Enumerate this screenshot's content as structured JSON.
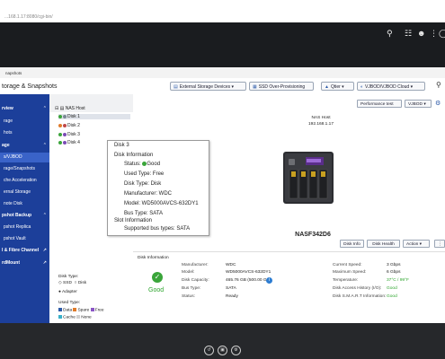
{
  "browser": {
    "url": "...168.1.17:8080/cgi-bin/"
  },
  "app": {
    "title": "torage & Snapshots",
    "tab_label": "napshots"
  },
  "toolbar": {
    "external": "External Storage Devices",
    "ssd": "SSD Over-Provisioning",
    "qtier": "Qtier",
    "vjbod": "VJBOD/VJBOD Cloud"
  },
  "nav": {
    "items": [
      {
        "label": "rview",
        "type": "sect"
      },
      {
        "label": "rage",
        "type": "sub"
      },
      {
        "label": "hots",
        "type": "sub"
      },
      {
        "label": "age",
        "type": "sect"
      },
      {
        "label": "s/VJBOD",
        "type": "sub",
        "active": true
      },
      {
        "label": "rage/Snapshots",
        "type": "sub"
      },
      {
        "label": "che Acceleration",
        "type": "sub"
      },
      {
        "label": "ernal Storage",
        "type": "sub"
      },
      {
        "label": "note Disk",
        "type": "sub"
      },
      {
        "label": "pshot Backup",
        "type": "sect"
      },
      {
        "label": "pshot Replica",
        "type": "sub"
      },
      {
        "label": "pshot Vault",
        "type": "sub"
      },
      {
        "label": "I & Fibre Channel",
        "type": "sect"
      },
      {
        "label": "rdMount",
        "type": "sect"
      }
    ]
  },
  "tree": {
    "host": "NAS Host",
    "disks": [
      {
        "label": "Disk 1",
        "color": "#3aa53a"
      },
      {
        "label": "Disk 2",
        "color": "#e07b2a"
      },
      {
        "label": "Disk 3",
        "color": "#3aa53a"
      },
      {
        "label": "Disk 4",
        "color": "#3aa53a"
      }
    ],
    "disk_type_label": "Disk Type:",
    "disk_types": [
      "SSD",
      "Disk",
      "Adapter"
    ],
    "used_type_label": "Used Type:",
    "used_types": [
      "Data",
      "Spare",
      "Free",
      "Cache",
      "None"
    ]
  },
  "tooltip": {
    "title": "Disk 3",
    "section1": "Disk Information",
    "status_label": "Status:",
    "status_value": "Good",
    "used_type": "Used Type: Free",
    "disk_type": "Disk Type: Disk",
    "manufacturer": "Manufacturer: WDC",
    "model": "Model: WD5000AVCS-632DY1",
    "bus_type": "Bus Type: SATA",
    "section2": "Slot Information",
    "supported": "Supported bus types: SATA"
  },
  "main": {
    "perf_test": "Performance test",
    "vjbod_btn": "VJBOD",
    "host_label": "NAS Host",
    "host_ip": "192.168.1.17",
    "model_name": "NASF342D6",
    "disk_info_btn": "Disk Info",
    "disk_health_btn": "Disk Health",
    "action_btn": "Action"
  },
  "info": {
    "heading": "Disk Information",
    "status": "Good",
    "left": [
      {
        "label": "Manufacturer:",
        "value": "WDC"
      },
      {
        "label": "Model:",
        "value": "WD5000AVCS-632DY1"
      },
      {
        "label": "Disk Capacity:",
        "value": "465.76 GB (500.00 GB)"
      },
      {
        "label": "Bus Type:",
        "value": "SATA"
      },
      {
        "label": "Status:",
        "value": "Ready"
      }
    ],
    "right": [
      {
        "label": "Current Speed:",
        "value": "3 Gbps",
        "green": false
      },
      {
        "label": "Maximum Speed:",
        "value": "6 Gbps",
        "green": false
      },
      {
        "label": "Temperature:",
        "value": "37°C / 99°F",
        "green": true
      },
      {
        "label": "Disk Access History (I/O):",
        "value": "Good",
        "green": true
      },
      {
        "label": "Disk S.M.A.R.T Information:",
        "value": "Good",
        "green": true
      }
    ]
  }
}
